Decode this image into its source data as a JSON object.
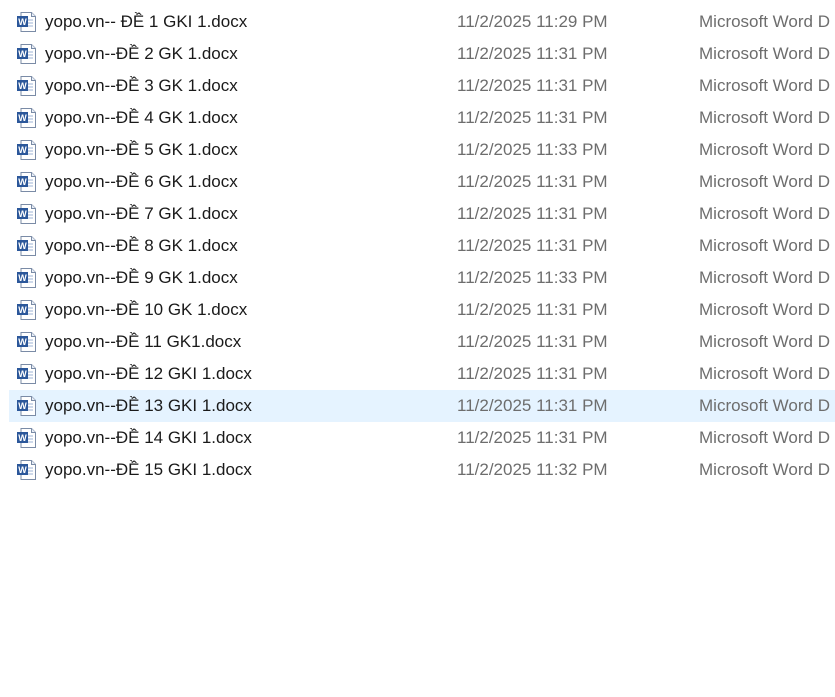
{
  "files": [
    {
      "name": "yopo.vn-- ĐỀ 1 GKI 1.docx",
      "date": "11/2/2025 11:29 PM",
      "type": "Microsoft Word D",
      "icon": "word-document-icon"
    },
    {
      "name": "yopo.vn--ĐỀ 2 GK 1.docx",
      "date": "11/2/2025 11:31 PM",
      "type": "Microsoft Word D",
      "icon": "word-document-icon"
    },
    {
      "name": "yopo.vn--ĐỀ 3 GK 1.docx",
      "date": "11/2/2025 11:31 PM",
      "type": "Microsoft Word D",
      "icon": "word-document-icon"
    },
    {
      "name": "yopo.vn--ĐỀ 4 GK 1.docx",
      "date": "11/2/2025 11:31 PM",
      "type": "Microsoft Word D",
      "icon": "word-document-icon"
    },
    {
      "name": "yopo.vn--ĐỀ 5 GK 1.docx",
      "date": "11/2/2025 11:33 PM",
      "type": "Microsoft Word D",
      "icon": "word-document-icon"
    },
    {
      "name": "yopo.vn--ĐỀ 6 GK 1.docx",
      "date": "11/2/2025 11:31 PM",
      "type": "Microsoft Word D",
      "icon": "word-document-icon"
    },
    {
      "name": "yopo.vn--ĐỀ 7 GK 1.docx",
      "date": "11/2/2025 11:31 PM",
      "type": "Microsoft Word D",
      "icon": "word-document-icon"
    },
    {
      "name": "yopo.vn--ĐỀ 8 GK 1.docx",
      "date": "11/2/2025 11:31 PM",
      "type": "Microsoft Word D",
      "icon": "word-document-icon"
    },
    {
      "name": "yopo.vn--ĐỀ 9 GK 1.docx",
      "date": "11/2/2025 11:33 PM",
      "type": "Microsoft Word D",
      "icon": "word-document-icon"
    },
    {
      "name": "yopo.vn--ĐỀ 10 GK 1.docx",
      "date": "11/2/2025 11:31 PM",
      "type": "Microsoft Word D",
      "icon": "word-document-icon"
    },
    {
      "name": "yopo.vn--ĐỀ 11 GK1.docx",
      "date": "11/2/2025 11:31 PM",
      "type": "Microsoft Word D",
      "icon": "word-document-icon"
    },
    {
      "name": "yopo.vn--ĐỀ 12 GKI 1.docx",
      "date": "11/2/2025 11:31 PM",
      "type": "Microsoft Word D",
      "icon": "word-document-icon"
    },
    {
      "name": "yopo.vn--ĐỀ 13 GKI 1.docx",
      "date": "11/2/2025 11:31 PM",
      "type": "Microsoft Word D",
      "icon": "word-document-icon",
      "hovered": true
    },
    {
      "name": "yopo.vn--ĐỀ 14 GKI 1.docx",
      "date": "11/2/2025 11:31 PM",
      "type": "Microsoft Word D",
      "icon": "word-document-icon"
    },
    {
      "name": "yopo.vn--ĐỀ 15 GKI 1.docx",
      "date": "11/2/2025 11:32 PM",
      "type": "Microsoft Word D",
      "icon": "word-document-icon"
    }
  ],
  "colors": {
    "hover_background": "#e5f3ff",
    "name_text": "#1a1a1a",
    "detail_text": "#6d6d6d",
    "word_blue": "#2b579a"
  }
}
